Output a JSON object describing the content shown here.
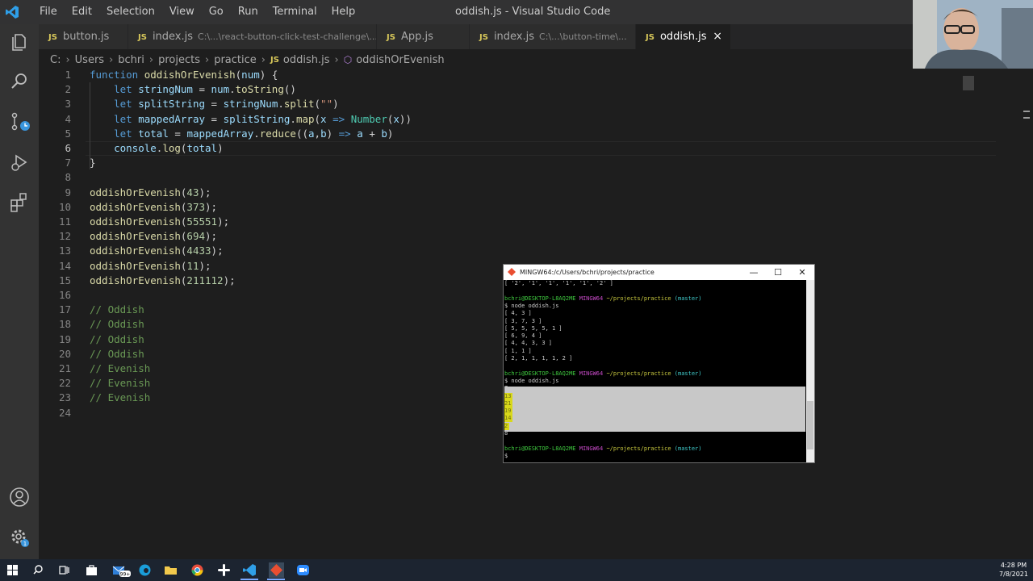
{
  "window": {
    "title": "oddish.js - Visual Studio Code"
  },
  "menu": [
    "File",
    "Edit",
    "Selection",
    "View",
    "Go",
    "Run",
    "Terminal",
    "Help"
  ],
  "tabs": [
    {
      "label": "button.js",
      "description": ""
    },
    {
      "label": "index.js",
      "description": "C:\\...\\react-button-click-test-challenge\\..."
    },
    {
      "label": "App.js",
      "description": ""
    },
    {
      "label": "index.js",
      "description": "C:\\...\\button-time\\..."
    },
    {
      "label": "oddish.js",
      "description": "",
      "close": "×"
    }
  ],
  "tab_badge": "JS",
  "breadcrumb": {
    "drive": "C:",
    "parts": [
      "Users",
      "bchri",
      "projects",
      "practice"
    ],
    "file": "oddish.js",
    "symbol": "oddishOrEvenish",
    "sep": "›"
  },
  "editor": {
    "line_numbers": [
      "1",
      "2",
      "3",
      "4",
      "5",
      "6",
      "7",
      "8",
      "9",
      "10",
      "11",
      "12",
      "13",
      "14",
      "15",
      "16",
      "17",
      "18",
      "19",
      "20",
      "21",
      "22",
      "23",
      "24"
    ],
    "lines": [
      "function oddishOrEvenish(num) {",
      "    let stringNum = num.toString()",
      "    let splitString = stringNum.split(\"\")",
      "    let mappedArray = splitString.map(x => Number(x))",
      "    let total = mappedArray.reduce((a,b) => a + b)",
      "    console.log(total)",
      "}",
      "",
      "oddishOrEvenish(43);",
      "oddishOrEvenish(373);",
      "oddishOrEvenish(55551);",
      "oddishOrEvenish(694);",
      "oddishOrEvenish(4433);",
      "oddishOrEvenish(11);",
      "oddishOrEvenish(211112);",
      "",
      "// Oddish",
      "// Oddish",
      "// Oddish",
      "// Oddish",
      "// Evenish",
      "// Evenish",
      "// Evenish",
      ""
    ],
    "current_line": 6
  },
  "terminal": {
    "title": "MINGW64:/c/Users/bchri/projects/practice",
    "controls": {
      "minimize": "—",
      "maximize": "☐",
      "close": "✕"
    },
    "prompt_user": "bchri@DESKTOP-L8AQ2ME",
    "prompt_env": "MINGW64",
    "prompt_path": "~/projects/practice",
    "prompt_branch": "(master)",
    "first_line": "[ '2', '1', '1', '1', '1', '2' ]",
    "command": "$ node oddish.js",
    "arrays": [
      "[ 4, 3 ]",
      "[ 3, 7, 3 ]",
      "[ 5, 5, 5, 5, 1 ]",
      "[ 6, 9, 4 ]",
      "[ 4, 4, 3, 3 ]",
      "[ 1, 1 ]",
      "[ 2, 1, 1, 1, 1, 2 ]"
    ],
    "results": [
      "7",
      "13",
      "21",
      "19",
      "14",
      "2",
      "8"
    ],
    "last_prompt": "$"
  },
  "taskbar": {
    "badge": "99+",
    "time": "4:28 PM",
    "date": "7/8/2021"
  },
  "colors": {
    "editor_bg": "#1e1e1e",
    "keyword": "#569cd6",
    "function": "#dcdcaa",
    "variable": "#9cdcfe",
    "string": "#ce9178",
    "number": "#b5cea8",
    "comment": "#6a9955",
    "selection_yellow": "#d8d81a"
  }
}
